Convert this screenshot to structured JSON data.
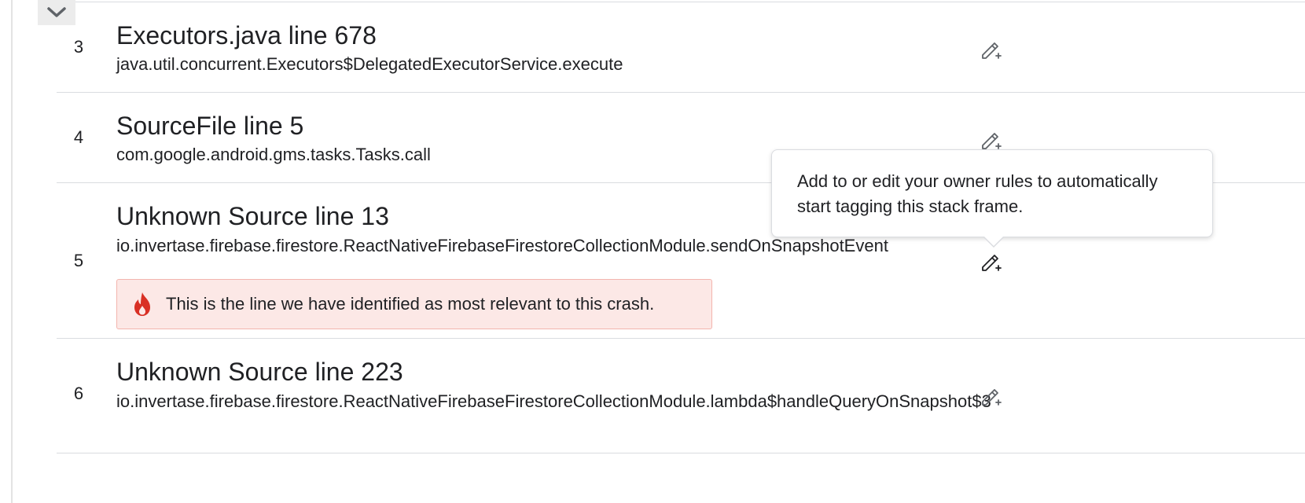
{
  "frames": [
    {
      "number": "3",
      "title": "Executors.java line 678",
      "method": "java.util.concurrent.Executors$DelegatedExecutorService.execute"
    },
    {
      "number": "4",
      "title": "SourceFile line 5",
      "method": "com.google.android.gms.tasks.Tasks.call"
    },
    {
      "number": "5",
      "title": "Unknown Source line 13",
      "method": "io.invertase.firebase.firestore.ReactNativeFirebaseFirestoreCollectionModule.sendOnSnapshotEvent",
      "relevant_text": "This is the line we have identified as most relevant to this crash."
    },
    {
      "number": "6",
      "title": "Unknown Source line 223",
      "method": "io.invertase.firebase.firestore.ReactNativeFirebaseFirestoreCollectionModule.lambda$handleQueryOnSnapshot$3"
    }
  ],
  "tooltip": {
    "text": "Add to or edit your owner rules to automatically start tagging this stack frame."
  },
  "icons": {
    "collapse": "chevron-down-icon",
    "edit": "edit-owner-rule-icon",
    "relevant": "fire-icon"
  },
  "colors": {
    "banner_bg": "#fce8e6",
    "banner_border": "#f3b5ae",
    "fire": "#d93025",
    "icon_gray": "#5f6368"
  }
}
